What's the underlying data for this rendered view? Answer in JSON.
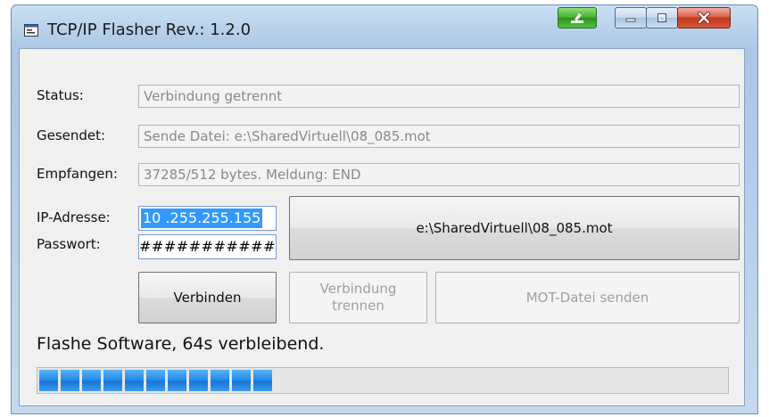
{
  "window": {
    "title": "TCP/IP Flasher Rev.: 1.2.0"
  },
  "form": {
    "status_label": "Status:",
    "status_value": "Verbindung getrennt",
    "sent_label": "Gesendet:",
    "sent_value": "Sende Datei: e:\\SharedVirtuell\\08_085.mot",
    "received_label": "Empfangen:",
    "received_value": "37285/512 bytes. Meldung: END",
    "ip_label": "IP-Adresse:",
    "ip_value": "10 .255.255.155",
    "password_label": "Passwort:",
    "password_value": "###########"
  },
  "buttons": {
    "file_label": "e:\\SharedVirtuell\\08_085.mot",
    "connect_label": "Verbinden",
    "disconnect_line1": "Verbindung",
    "disconnect_line2": "trennen",
    "send_label": "MOT-Datei senden"
  },
  "progress": {
    "message": "Flashe Software, 64s verbleibend.",
    "fraction": 0.33
  },
  "icons": {
    "app": "app-window-icon",
    "extra": "highlighter-icon",
    "minimize": "minimize-icon",
    "maximize": "maximize-icon",
    "close": "close-icon"
  },
  "colors": {
    "progress": "#1e82e0",
    "selection": "#3399ff",
    "close": "#c2381f"
  }
}
